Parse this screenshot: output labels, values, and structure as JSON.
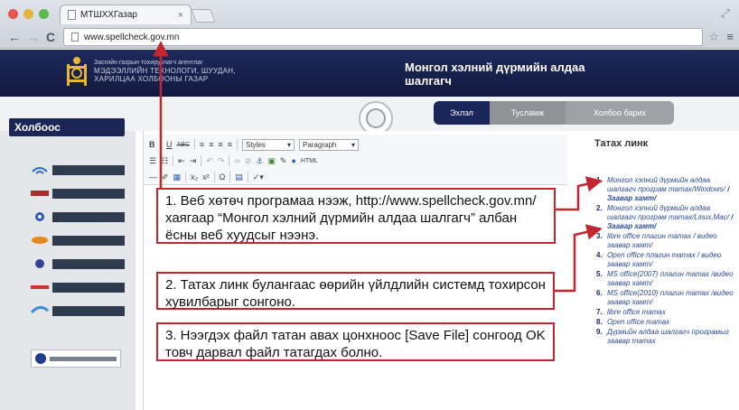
{
  "browser": {
    "tab_title": "МТШХХГазар",
    "tab_close": "×",
    "url": "www.spellcheck.gov.mn"
  },
  "site": {
    "org_lines": [
      "Засгийн газрын тохируулагч агентлаг",
      "МЭДЭЭЛЛИЙН ТЕХНОЛОГИ, ШУУДАН,",
      "ХАРИЛЦАА ХОЛБООНЫ ГАЗАР"
    ],
    "title": "Монгол хэлний дүрмийн алдаа шалгагч",
    "nav_tabs": [
      "Эхлэл",
      "Тусламж",
      "Холбоо барих"
    ]
  },
  "sidebar": {
    "title": "Холбоос"
  },
  "editor": {
    "styles_label": "Styles",
    "paragraph_label": "Paragraph"
  },
  "right_panel": {
    "title": "Татах линк",
    "links": [
      {
        "num": "1.",
        "text": "Монгол хэлний дүрмийн алдаа шалгагч програм татах/Windows/ ",
        "bold": "/Заавар хамт/"
      },
      {
        "num": "2.",
        "text": "Монгол хэлний дүрмийн алдаа шалгагч програм татах/Linux,Mac/ ",
        "bold": "/Заавар хамт/"
      },
      {
        "num": "3.",
        "text": "libre office плагин татах / видео заавар хамт/",
        "bold": ""
      },
      {
        "num": "4.",
        "text": "Open office плагин татах / видео заавар хамт/",
        "bold": ""
      },
      {
        "num": "5.",
        "text": "MS office(2007) плагин татах /видео заавар хамт/",
        "bold": ""
      },
      {
        "num": "6.",
        "text": "MS office(2010) плагин татах /видео заавар хамт/",
        "bold": ""
      },
      {
        "num": "7.",
        "text": "libre office татах",
        "bold": ""
      },
      {
        "num": "8.",
        "text": "Open office татах",
        "bold": ""
      },
      {
        "num": "9.",
        "text": "Дүрмийн алдаа шалгагч програмыг заавар татах",
        "bold": ""
      }
    ]
  },
  "callouts": {
    "step1": "1. Веб хөтөч програмаа нээж, http://www.spellcheck.gov.mn/ хаягаар “Монгол хэлний дүрмийн алдаа шалгагч” албан ёсны веб хуудсыг нээнэ.",
    "step2": "2. Татах линк булангаас өөрийн үйлдлийн системд тохирсон хувилбарыг сонгоно.",
    "step3": "3. Нээгдэх файл татан авах цонхноос [Save File] сонгоод OK товч дарвал файл татагдах болно."
  },
  "colors": {
    "header_navy": "#1a2558",
    "annotation_red": "#c2262e",
    "link_blue": "#2c4a98"
  }
}
